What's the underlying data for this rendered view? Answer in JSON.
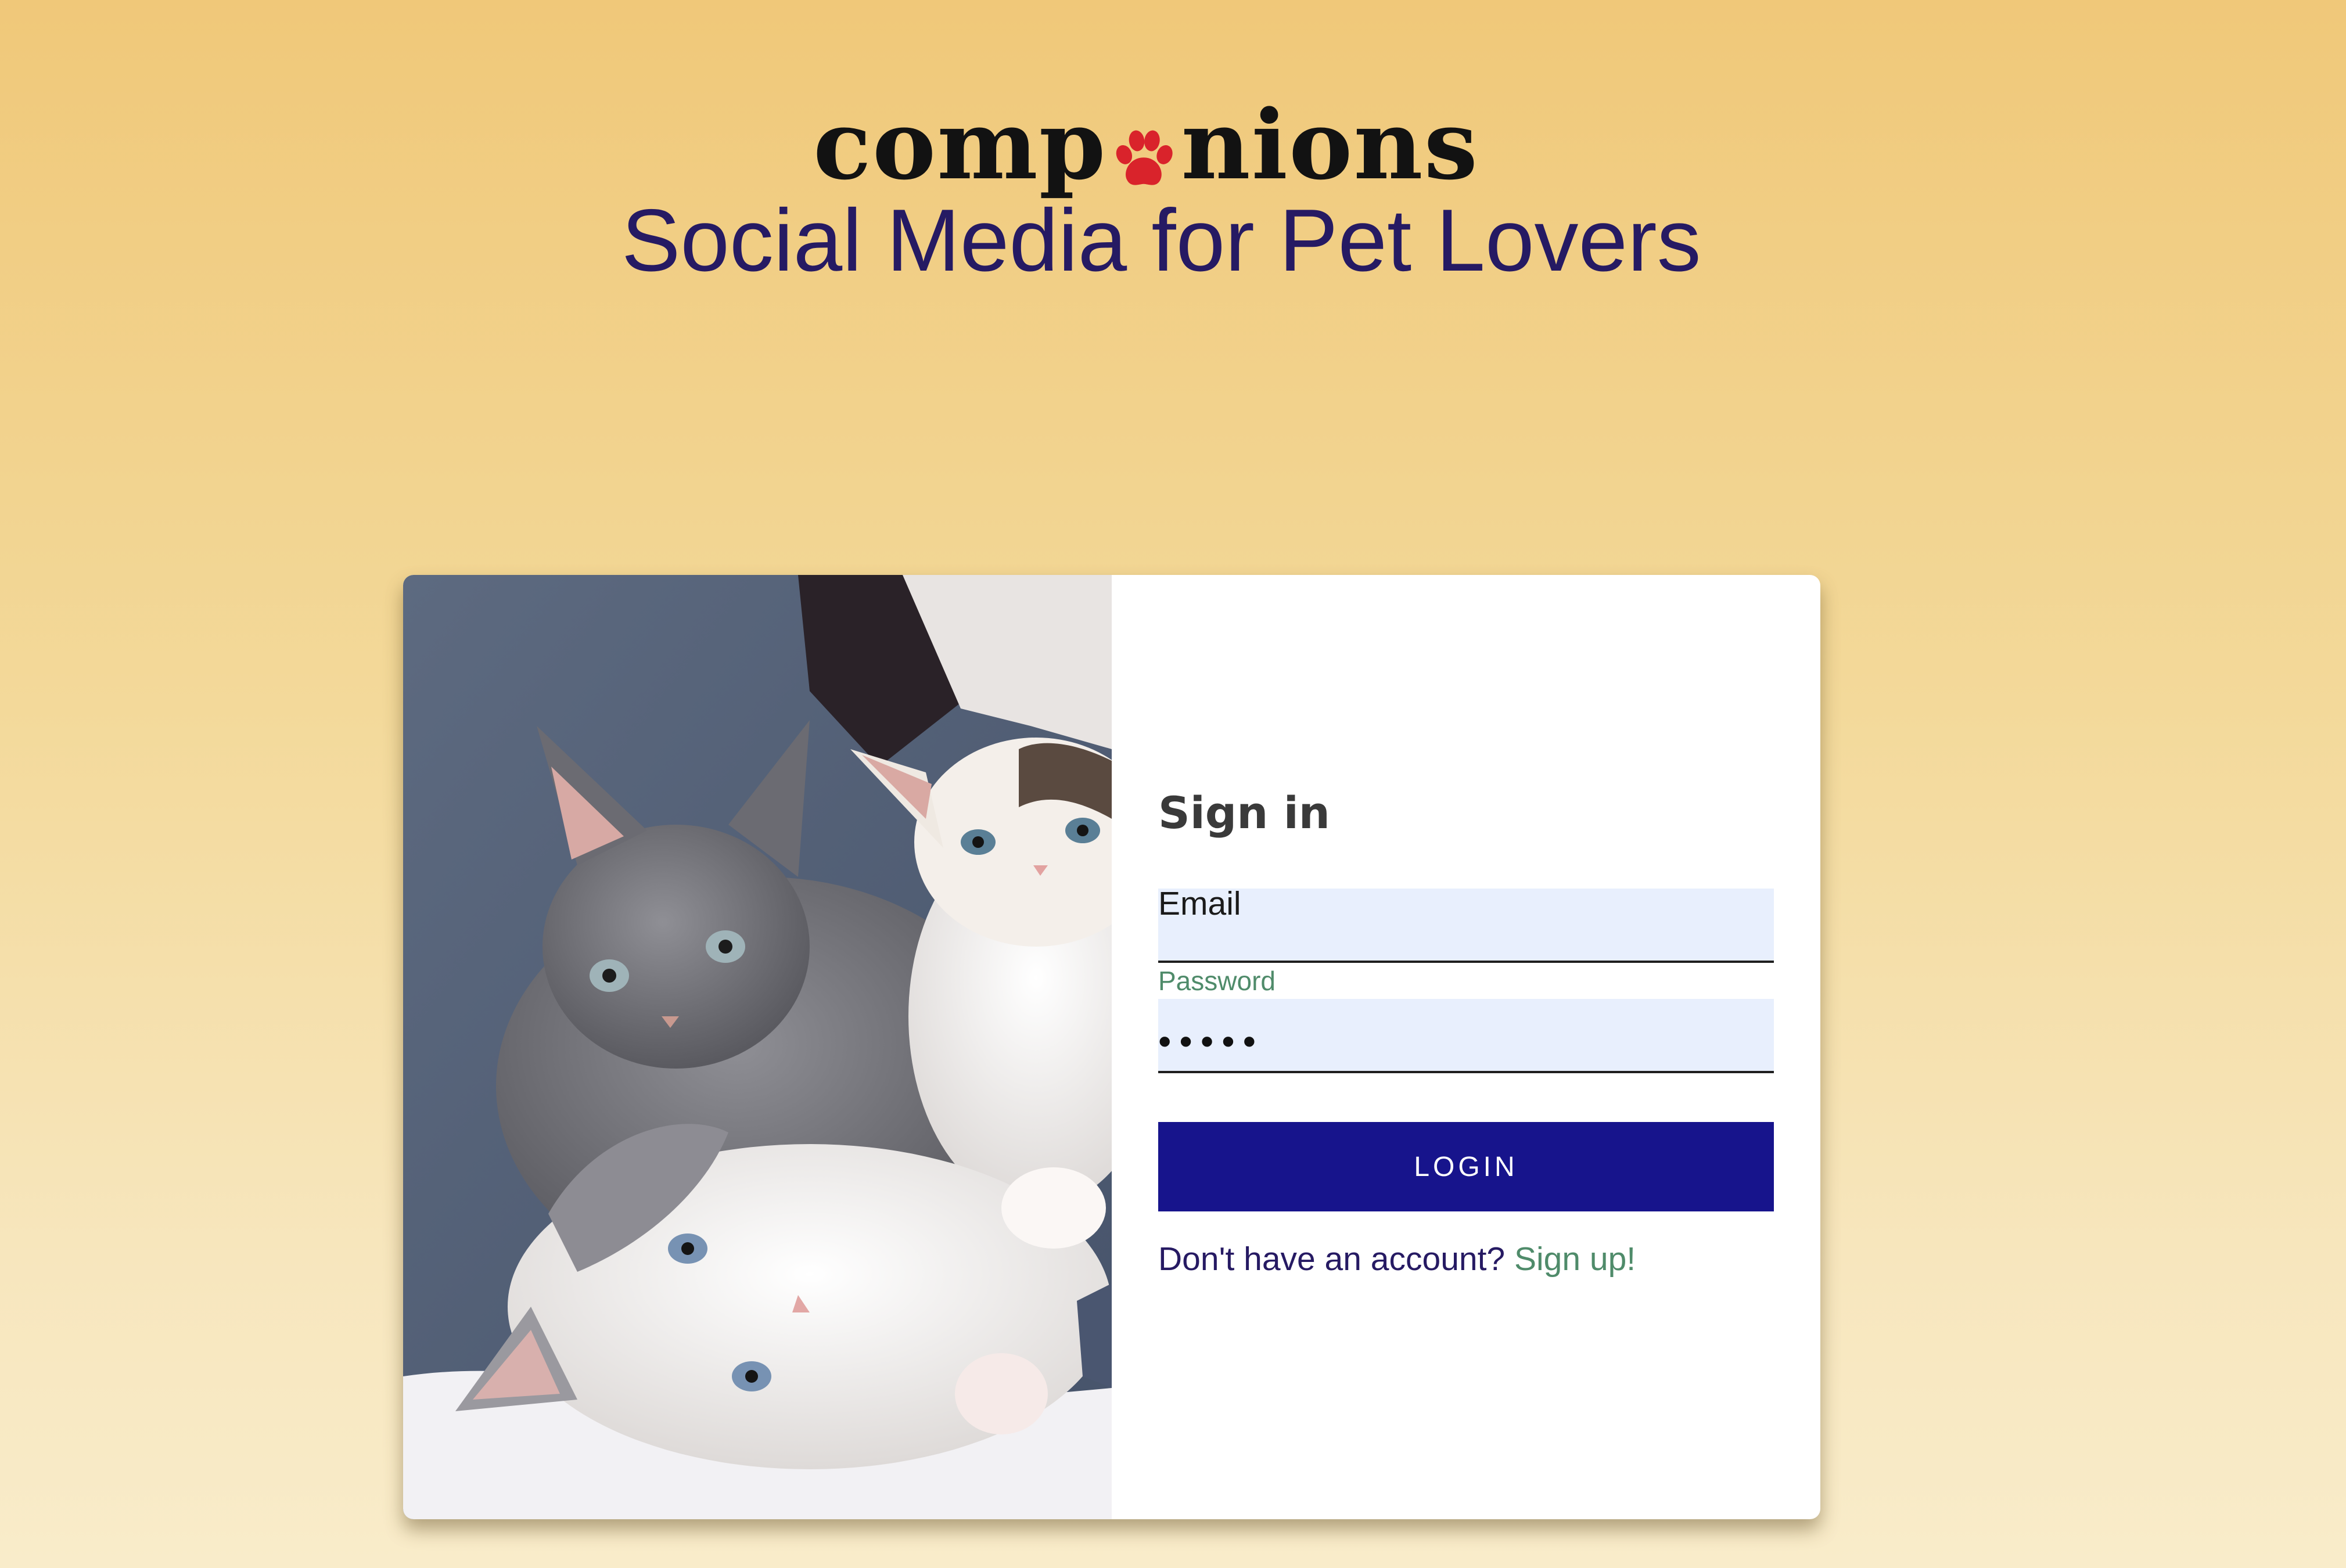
{
  "header": {
    "logo_text_left": "comp",
    "logo_text_right": "nions",
    "logo_icon": "paw-icon",
    "tagline": "Social Media for Pet Lovers"
  },
  "colors": {
    "paw": "#d9232b",
    "tagline": "#261a63",
    "button": "#17148c",
    "link": "#4f8b6a",
    "field_bg": "#e8effd"
  },
  "image": {
    "content": "kittens-photo"
  },
  "signin": {
    "title": "Sign in",
    "email_label": "Email",
    "email_value": "",
    "password_label": "Password",
    "password_value": "•••••",
    "login_label": "LOGIN",
    "prompt_text": "Don't have an account? ",
    "signup_link": "Sign up!"
  }
}
